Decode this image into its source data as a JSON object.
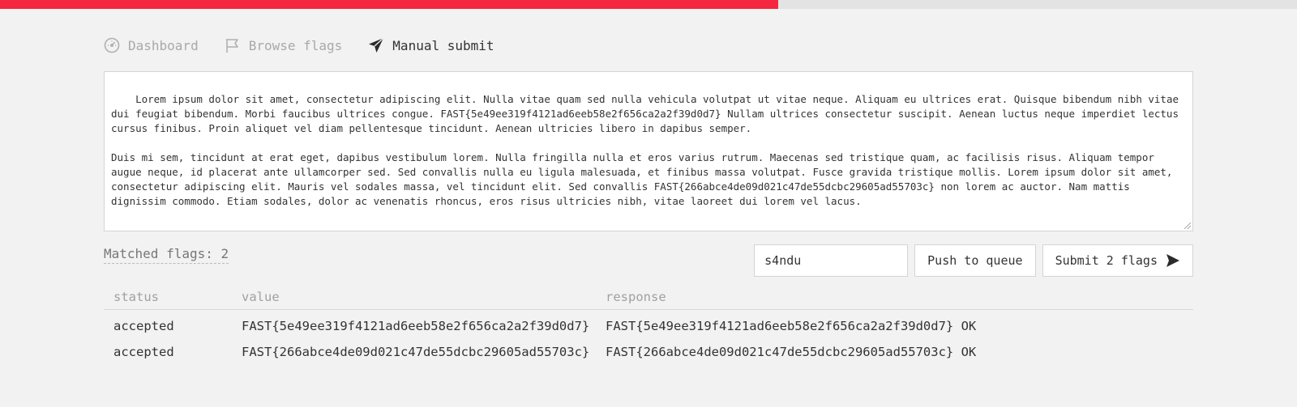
{
  "progress": {
    "fraction": 0.6,
    "fill_color": "#f5263f",
    "track_color": "#e3e3e3"
  },
  "nav": {
    "items": [
      {
        "label": "Dashboard",
        "icon": "gauge-icon",
        "active": false
      },
      {
        "label": "Browse flags",
        "icon": "flag-icon",
        "active": false
      },
      {
        "label": "Manual submit",
        "icon": "paper-plane-icon",
        "active": true
      }
    ]
  },
  "editor": {
    "text": "Lorem ipsum dolor sit amet, consectetur adipiscing elit. Nulla vitae quam sed nulla vehicula volutpat ut vitae neque. Aliquam eu ultrices erat. Quisque bibendum nibh vitae dui feugiat bibendum. Morbi faucibus ultrices congue. FAST{5e49ee319f4121ad6eeb58e2f656ca2a2f39d0d7} Nullam ultrices consectetur suscipit. Aenean luctus neque imperdiet lectus cursus finibus. Proin aliquet vel diam pellentesque tincidunt. Aenean ultricies libero in dapibus semper.\n\nDuis mi sem, tincidunt at erat eget, dapibus vestibulum lorem. Nulla fringilla nulla et eros varius rutrum. Maecenas sed tristique quam, ac facilisis risus. Aliquam tempor augue neque, id placerat ante ullamcorper sed. Sed convallis nulla eu ligula malesuada, et finibus massa volutpat. Fusce gravida tristique mollis. Lorem ipsum dolor sit amet, consectetur adipiscing elit. Mauris vel sodales massa, vel tincidunt elit. Sed convallis FAST{266abce4de09d021c47de55dcbc29605ad55703c} non lorem ac auctor. Nam mattis dignissim commodo. Etiam sodales, dolor ac venenatis rhoncus, eros risus ultricies nibh, vitae laoreet dui lorem vel lacus."
  },
  "controls": {
    "matched_label": "Matched flags: 2",
    "team_input_value": "s4ndu",
    "push_label": "Push to queue",
    "submit_label": "Submit 2 flags"
  },
  "table": {
    "headers": {
      "status": "status",
      "value": "value",
      "response": "response"
    },
    "rows": [
      {
        "status": "accepted",
        "value": "FAST{5e49ee319f4121ad6eeb58e2f656ca2a2f39d0d7}",
        "response": "FAST{5e49ee319f4121ad6eeb58e2f656ca2a2f39d0d7} OK"
      },
      {
        "status": "accepted",
        "value": "FAST{266abce4de09d021c47de55dcbc29605ad55703c}",
        "response": "FAST{266abce4de09d021c47de55dcbc29605ad55703c} OK"
      }
    ]
  }
}
